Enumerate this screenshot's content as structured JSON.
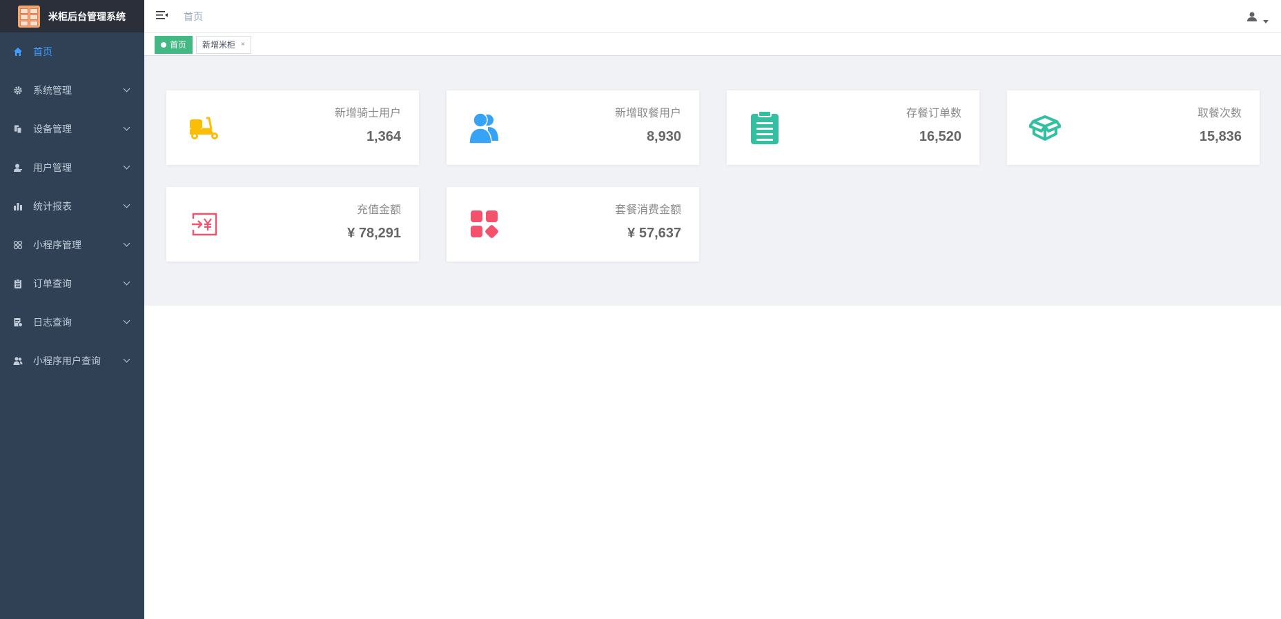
{
  "app": {
    "title": "米柜后台管理系统"
  },
  "sidebar": {
    "items": [
      {
        "label": "首页",
        "icon": "home-icon",
        "active": true
      },
      {
        "label": "系统管理",
        "icon": "gear-icon"
      },
      {
        "label": "设备管理",
        "icon": "devices-icon"
      },
      {
        "label": "用户管理",
        "icon": "user-icon"
      },
      {
        "label": "统计报表",
        "icon": "bar-chart-icon"
      },
      {
        "label": "小程序管理",
        "icon": "mini-program-icon"
      },
      {
        "label": "订单查询",
        "icon": "clipboard-icon"
      },
      {
        "label": "日志查询",
        "icon": "log-icon"
      },
      {
        "label": "小程序用户查询",
        "icon": "users-icon"
      }
    ]
  },
  "header": {
    "breadcrumb": "首页"
  },
  "tags": [
    {
      "label": "首页",
      "active": true
    },
    {
      "label": "新增米柜",
      "close": "×"
    }
  ],
  "stats": [
    {
      "label": "新增骑士用户",
      "value": "1,364",
      "icon": "scooter-icon",
      "color": "#fbbd08"
    },
    {
      "label": "新增取餐用户",
      "value": "8,930",
      "icon": "users-icon",
      "color": "#36a3f7"
    },
    {
      "label": "存餐订单数",
      "value": "16,520",
      "icon": "clipboard-icon",
      "color": "#34bfa3"
    },
    {
      "label": "取餐次数",
      "value": "15,836",
      "icon": "box-icon",
      "color": "#34bfa3"
    },
    {
      "label": "充值金额",
      "value": "¥ 78,291",
      "icon": "recharge-yen-icon",
      "color": "#f4516c"
    },
    {
      "label": "套餐消费金额",
      "value": "¥ 57,637",
      "icon": "apps-icon",
      "color": "#f4516c"
    }
  ],
  "colors": {
    "sidebar_bg": "#304156",
    "menu_text": "#bfcbd9",
    "menu_active": "#409eff",
    "tag_active": "#42b983",
    "panel_bg": "#f0f2f5"
  }
}
